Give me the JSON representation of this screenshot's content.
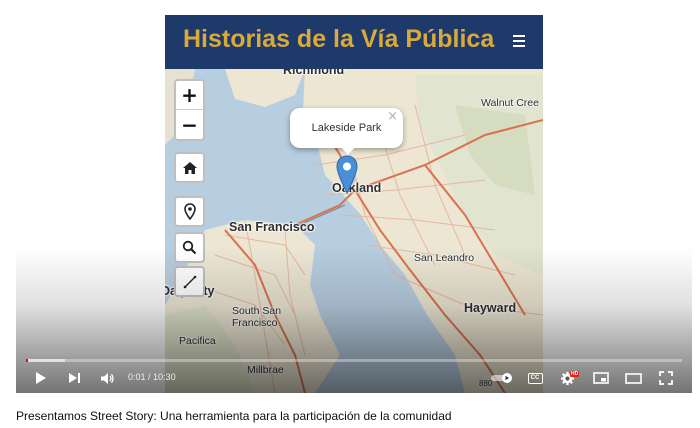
{
  "app": {
    "title": "Historias de la Vía Pública"
  },
  "map": {
    "popup_text": "Lakeside Park",
    "popup_close": "×",
    "zoom_in": "+",
    "zoom_out": "−",
    "places": {
      "richmond": "Richmond",
      "walnut_creek": "Walnut Cree",
      "oakland": "Oakland",
      "san_francisco": "San Francisco",
      "san_leandro": "San Leandro",
      "daly_city": "Daly City",
      "south_san_francisco_1": "South San",
      "south_san_francisco_2": "Francisco",
      "hayward": "Hayward",
      "pacifica": "Pacifica",
      "millbrae": "Millbrae",
      "route_880": "880"
    },
    "colors": {
      "water": "#b7cde0",
      "land": "#efe9d8",
      "header": "#1d3a6b",
      "title": "#d9a93c",
      "marker": "#4a8fd6"
    },
    "icons": [
      "home-icon",
      "map-pin-icon",
      "search-icon",
      "measure-icon"
    ]
  },
  "player": {
    "time_current": "0:01",
    "time_separator": " / ",
    "time_total": "10:30",
    "progress_played_fraction": 0.0016,
    "progress_buffered_fraction": 0.06,
    "cc_label": "CC",
    "hd_label": "HD",
    "icons": [
      "play-icon",
      "next-icon",
      "volume-icon",
      "autoplay-toggle-icon",
      "cc-icon",
      "settings-icon",
      "miniplayer-icon",
      "theater-icon",
      "fullscreen-icon"
    ]
  },
  "video": {
    "caption": "Presentamos Street Story: Una herramienta para la participación de la comunidad"
  }
}
